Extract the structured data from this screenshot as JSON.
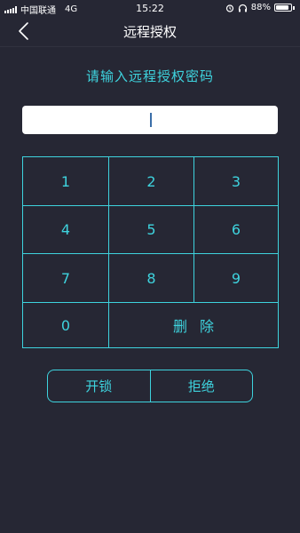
{
  "status_bar": {
    "carrier": "中国联通",
    "network": "4G",
    "time": "15:22",
    "battery": "88%",
    "battery_level": 0.88,
    "icons": [
      "signal-icon",
      "alarm-icon",
      "headphones-icon",
      "battery-icon"
    ]
  },
  "nav": {
    "title": "远程授权",
    "back_icon": "chevron-left-icon"
  },
  "prompt": "请输入远程授权密码",
  "password_field": {
    "value": ""
  },
  "keypad": {
    "keys": [
      "1",
      "2",
      "3",
      "4",
      "5",
      "6",
      "7",
      "8",
      "9",
      "0"
    ],
    "delete_label": "删除"
  },
  "actions": {
    "unlock": "开锁",
    "reject": "拒绝"
  },
  "colors": {
    "background": "#262734",
    "accent": "#3ed3de",
    "text": "#ffffff"
  }
}
